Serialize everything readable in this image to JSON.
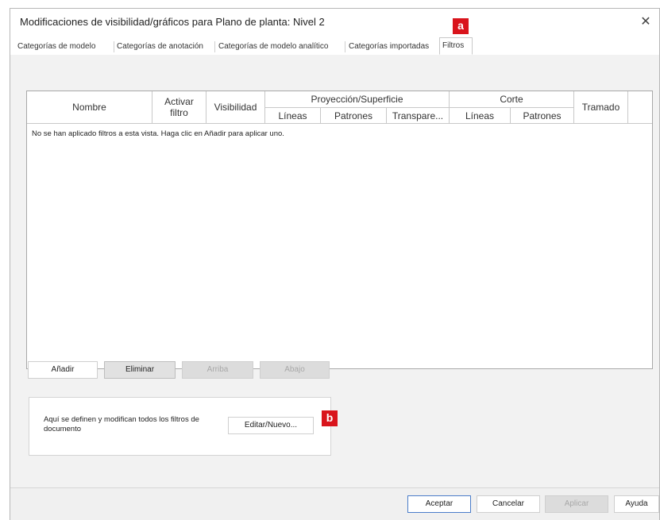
{
  "dialog": {
    "title": "Modificaciones de visibilidad/gráficos para Plano de planta: Nivel 2",
    "close_glyph": "✕"
  },
  "tabs": [
    {
      "label": "Categorías de modelo"
    },
    {
      "label": "Categorías de anotación"
    },
    {
      "label": "Categorías de modelo analítico"
    },
    {
      "label": "Categorías importadas"
    },
    {
      "label": "Filtros",
      "active": true
    }
  ],
  "callouts": {
    "a": "a",
    "b": "b",
    "color": "#d9141c"
  },
  "grid": {
    "headers": {
      "nombre": "Nombre",
      "activar_filtro": "Activar filtro",
      "visibilidad": "Visibilidad",
      "proyeccion": "Proyección/Superficie",
      "proy_lineas": "Líneas",
      "proy_patrones": "Patrones",
      "proy_transparencia": "Transpare...",
      "corte": "Corte",
      "corte_lineas": "Líneas",
      "corte_patrones": "Patrones",
      "tramado": "Tramado"
    },
    "empty_message": "No se han aplicado filtros a esta vista. Haga clic en Añadir para aplicar uno."
  },
  "row_buttons": {
    "add": "Añadir",
    "remove": "Eliminar",
    "up": "Arriba",
    "down": "Abajo"
  },
  "info": {
    "text": "Aquí se definen y modifican todos los filtros de documento",
    "edit_button": "Editar/Nuevo..."
  },
  "footer": {
    "ok": "Aceptar",
    "cancel": "Cancelar",
    "apply": "Aplicar",
    "help": "Ayuda"
  }
}
